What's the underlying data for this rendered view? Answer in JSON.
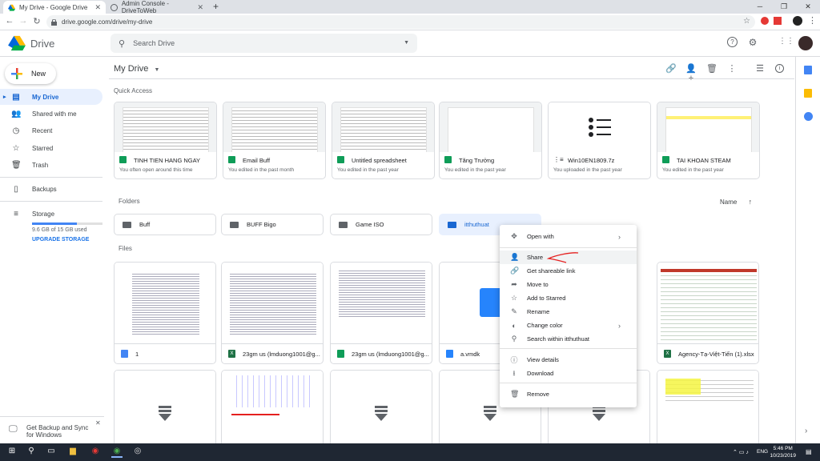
{
  "browser": {
    "tabs": [
      {
        "title": "My Drive - Google Drive",
        "active": true
      },
      {
        "title": "Admin Console - DriveToWeb",
        "active": false
      }
    ],
    "new_tab_glyph": "+",
    "url": "drive.google.com/drive/my-drive"
  },
  "header": {
    "app_name": "Drive",
    "search_placeholder": "Search Drive"
  },
  "sidebar": {
    "new_label": "New",
    "items": [
      {
        "label": "My Drive",
        "icon": "drive-icon",
        "active": true
      },
      {
        "label": "Shared with me",
        "icon": "people-icon"
      },
      {
        "label": "Recent",
        "icon": "clock-icon"
      },
      {
        "label": "Starred",
        "icon": "star-icon"
      },
      {
        "label": "Trash",
        "icon": "trash-icon"
      },
      {
        "label": "Backups",
        "icon": "backup-icon"
      },
      {
        "label": "Storage",
        "icon": "storage-icon"
      }
    ],
    "storage_used_fraction": 0.64,
    "storage_text": "9.6 GB of 15 GB used",
    "upgrade_label": "UPGRADE STORAGE",
    "backup_banner": "Get Backup and Sync for Windows"
  },
  "main": {
    "title": "My Drive",
    "quick_access_label": "Quick Access",
    "quick_access": [
      {
        "name": "TINH TIEN HANG NGAY",
        "sub": "You often open around this time",
        "type": "sheet"
      },
      {
        "name": "Email Buff",
        "sub": "You edited in the past month",
        "type": "sheet"
      },
      {
        "name": "Untitled spreadsheet",
        "sub": "You edited in the past year",
        "type": "sheet"
      },
      {
        "name": "Tăng Trưởng",
        "sub": "You edited in the past year",
        "type": "sheet"
      },
      {
        "name": "Win10EN1809.7z",
        "sub": "You uploaded in the past year",
        "type": "archive"
      },
      {
        "name": "TAI KHOAN STEAM",
        "sub": "You edited in the past year",
        "type": "sheet"
      }
    ],
    "folders_label": "Folders",
    "sort_label": "Name",
    "folders": [
      "Buff",
      "BUFF Bigo",
      "Game ISO",
      "itthuthuat"
    ],
    "files_label": "Files",
    "files": [
      {
        "name": "1",
        "type": "doc"
      },
      {
        "name": "23gm us (lmduong1001@g...",
        "type": "excel"
      },
      {
        "name": "23gm us (lmduong1001@g...",
        "type": "sheet"
      },
      {
        "name": "a.vmdk",
        "type": "file"
      },
      {
        "name": "",
        "type": "hidden"
      },
      {
        "name": "Agency-Tạ-Việt-Tiến (1).xlsx",
        "type": "excel"
      }
    ]
  },
  "context_menu": {
    "items": [
      {
        "label": "Open with",
        "icon": "open-with-icon",
        "submenu": true
      },
      {
        "label": "Share",
        "icon": "share-icon",
        "highlighted": true
      },
      {
        "label": "Get shareable link",
        "icon": "link-icon"
      },
      {
        "label": "Move to",
        "icon": "move-icon"
      },
      {
        "label": "Add to Starred",
        "icon": "star-icon"
      },
      {
        "label": "Rename",
        "icon": "rename-icon"
      },
      {
        "label": "Change color",
        "icon": "palette-icon",
        "submenu": true
      },
      {
        "label": "Search within itthuthuat",
        "icon": "search-icon"
      },
      {
        "label": "View details",
        "icon": "info-icon"
      },
      {
        "label": "Download",
        "icon": "download-icon"
      },
      {
        "label": "Remove",
        "icon": "trash-icon"
      }
    ]
  },
  "taskbar": {
    "lang": "ENG",
    "time": "5:46 PM",
    "date": "10/23/2019"
  },
  "colors": {
    "sheet_green": "#0f9d58",
    "excel_green": "#1e7145",
    "doc_blue": "#4285f4",
    "accent_blue": "#1967d2",
    "annotation_red": "#e5201f"
  }
}
